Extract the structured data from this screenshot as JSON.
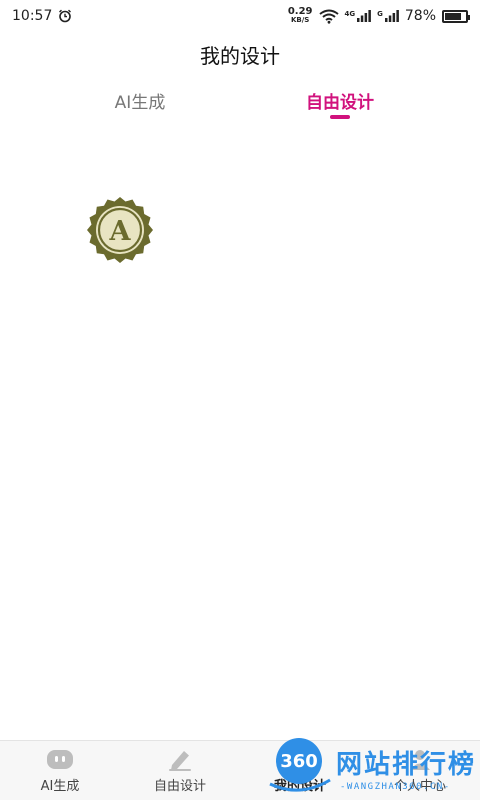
{
  "status_bar": {
    "time": "10:57",
    "net_speed_value": "0.29",
    "net_speed_unit": "KB/S",
    "signal1_tag": "4G",
    "signal2_tag": "G",
    "battery": "78%",
    "battery_level": 0.78
  },
  "header": {
    "title": "我的设计"
  },
  "tabs": [
    {
      "label": "AI生成",
      "active": false
    },
    {
      "label": "自由设计",
      "active": true
    }
  ],
  "accent_color": "#d1127d",
  "design": {
    "badge_letter": "A",
    "badge_color": "#6b6b2e"
  },
  "bottom_nav": [
    {
      "label": "AI生成",
      "icon": "robot-icon"
    },
    {
      "label": "自由设计",
      "icon": "pencil-icon"
    },
    {
      "label": "我的设计",
      "icon": "folder-icon"
    },
    {
      "label": "个人中心",
      "icon": "user-icon"
    }
  ],
  "watermark": {
    "circle_text": "360",
    "title": "网站排行榜",
    "subtitle": "-WANGZHAN360.CN-"
  }
}
